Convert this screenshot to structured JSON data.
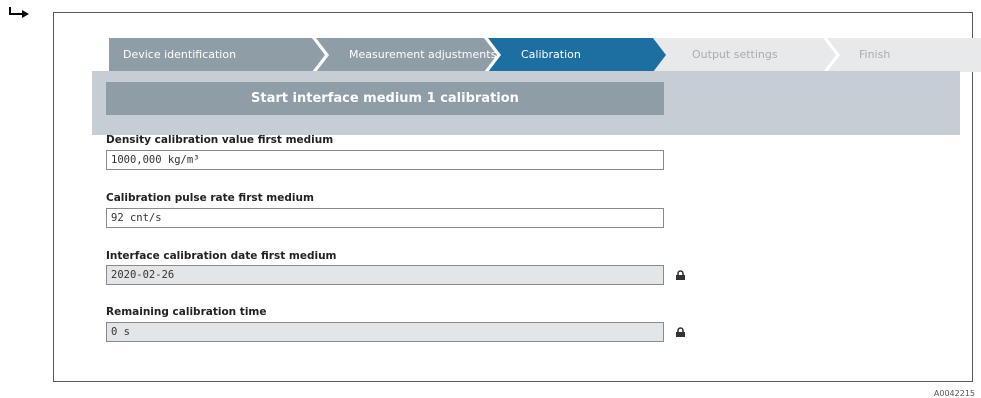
{
  "wizard": {
    "steps": [
      {
        "label": "Device identification",
        "state": "done"
      },
      {
        "label": "Measurement adjustments",
        "state": "done"
      },
      {
        "label": "Calibration",
        "state": "active"
      },
      {
        "label": "Output settings",
        "state": "pending"
      },
      {
        "label": "Finish",
        "state": "pending"
      }
    ]
  },
  "main": {
    "start_button": "Start interface medium 1 calibration",
    "fields": [
      {
        "label": "Density calibration value first medium",
        "value": "1000,000 kg/m³",
        "readonly": false
      },
      {
        "label": "Calibration pulse rate first medium",
        "value": "92 cnt/s",
        "readonly": false
      },
      {
        "label": "Interface calibration date first medium",
        "value": "2020-02-26",
        "readonly": true
      },
      {
        "label": "Remaining calibration time",
        "value": "0 s",
        "readonly": true
      }
    ]
  },
  "figure_id": "A0042215",
  "colors": {
    "step_done": "#8e9da6",
    "step_active": "#1c6fa0",
    "step_pending": "#e8e9ea",
    "band": "#c6ced4",
    "readonly_field": "#e3e6e8"
  },
  "icons": [
    "step-arrow-icon",
    "lock-icon"
  ]
}
